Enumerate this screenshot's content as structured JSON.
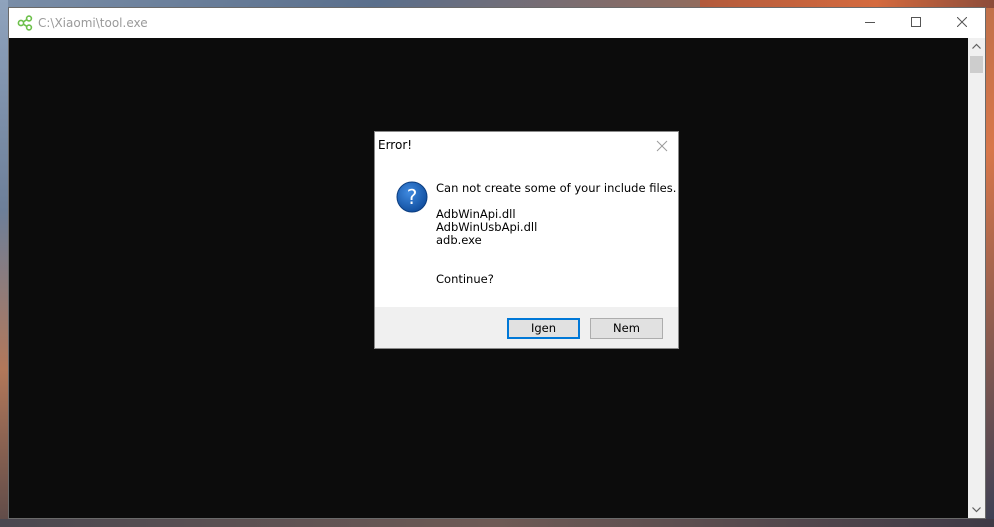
{
  "window": {
    "title": "C:\\Xiaomi\\tool.exe",
    "icons": {
      "app": "share-nodes-icon",
      "minimize": "minimize-icon",
      "maximize": "maximize-icon",
      "close": "close-icon"
    },
    "accent": "#6cc04a"
  },
  "dialog": {
    "title": "Error!",
    "icon": "question-icon",
    "icon_color": "#1a5fb4",
    "message_line": "Can not create some of your include files.",
    "files": [
      "AdbWinApi.dll",
      "AdbWinUsbApi.dll",
      "adb.exe"
    ],
    "prompt": "Continue?",
    "buttons": {
      "yes_label": "Igen",
      "no_label": "Nem"
    },
    "default_button_color": "#0078d7"
  }
}
